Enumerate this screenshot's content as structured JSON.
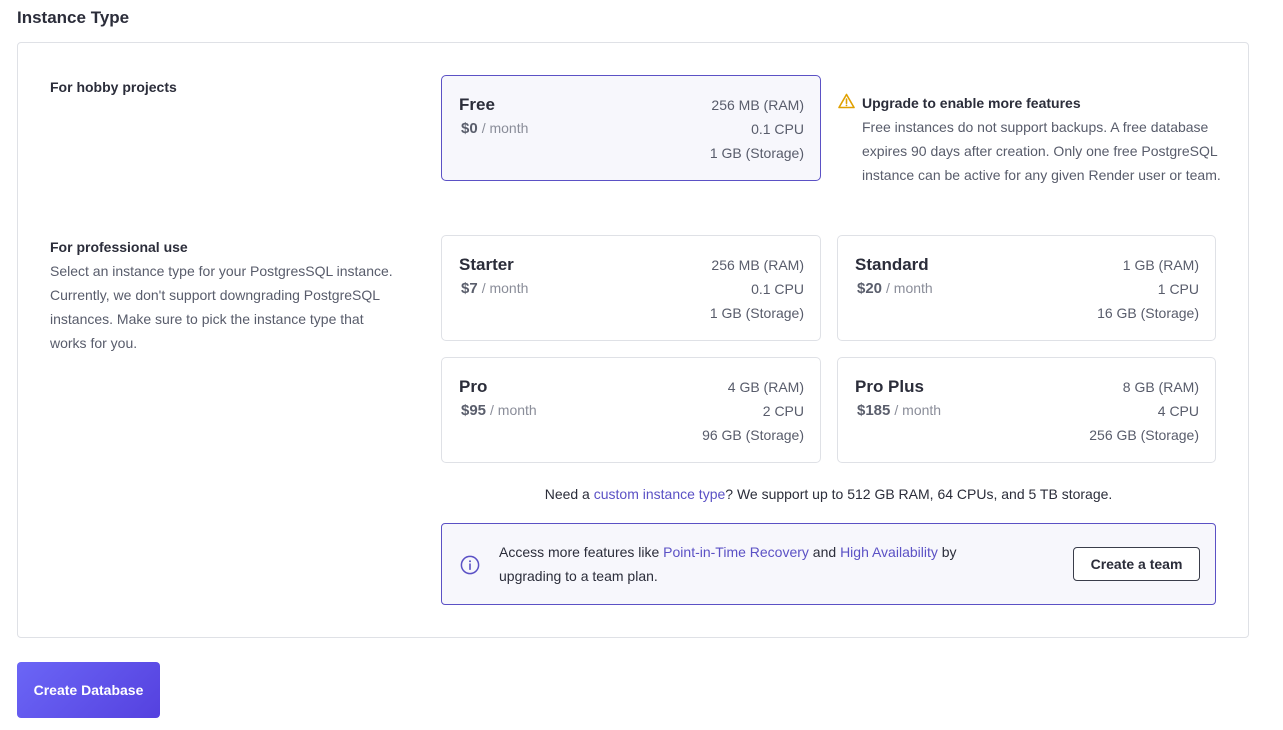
{
  "section_title": "Instance Type",
  "hobby": {
    "heading": "For hobby projects"
  },
  "professional": {
    "heading": "For professional use",
    "description": "Select an instance type for your PostgresSQL instance. Currently, we don't support downgrading PostgreSQL instances. Make sure to pick the instance type that works for you."
  },
  "plans": [
    {
      "name": "Free",
      "price": "$0",
      "period": "/ month",
      "ram": "256 MB (RAM)",
      "cpu": "0.1 CPU",
      "storage": "1 GB (Storage)",
      "selected": true
    },
    {
      "name": "Starter",
      "price": "$7",
      "period": "/ month",
      "ram": "256 MB (RAM)",
      "cpu": "0.1 CPU",
      "storage": "1 GB (Storage)",
      "selected": false
    },
    {
      "name": "Standard",
      "price": "$20",
      "period": "/ month",
      "ram": "1 GB (RAM)",
      "cpu": "1 CPU",
      "storage": "16 GB (Storage)",
      "selected": false
    },
    {
      "name": "Pro",
      "price": "$95",
      "period": "/ month",
      "ram": "4 GB (RAM)",
      "cpu": "2 CPU",
      "storage": "96 GB (Storage)",
      "selected": false
    },
    {
      "name": "Pro Plus",
      "price": "$185",
      "period": "/ month",
      "ram": "8 GB (RAM)",
      "cpu": "4 CPU",
      "storage": "256 GB (Storage)",
      "selected": false
    }
  ],
  "warning": {
    "icon": "warning-triangle-icon",
    "title": "Upgrade to enable more features",
    "body": "Free instances do not support backups. A free database expires 90 days after creation. Only one free PostgreSQL instance can be active for any given Render user or team."
  },
  "custom": {
    "prefix": "Need a ",
    "link": "custom instance type",
    "suffix": "? We support up to 512 GB RAM, 64 CPUs, and 5 TB storage."
  },
  "info": {
    "icon": "info-circle-icon",
    "prefix": "Access more features like ",
    "link1": "Point-in-Time Recovery",
    "middle": " and ",
    "link2": "High Availability",
    "suffix": " by upgrading to a team plan.",
    "button": "Create a team"
  },
  "create_button": "Create Database",
  "colors": {
    "accent": "#5b51c5",
    "warning": "#e0a000",
    "button_gradient_start": "#6b66f6",
    "button_gradient_end": "#5541df"
  }
}
